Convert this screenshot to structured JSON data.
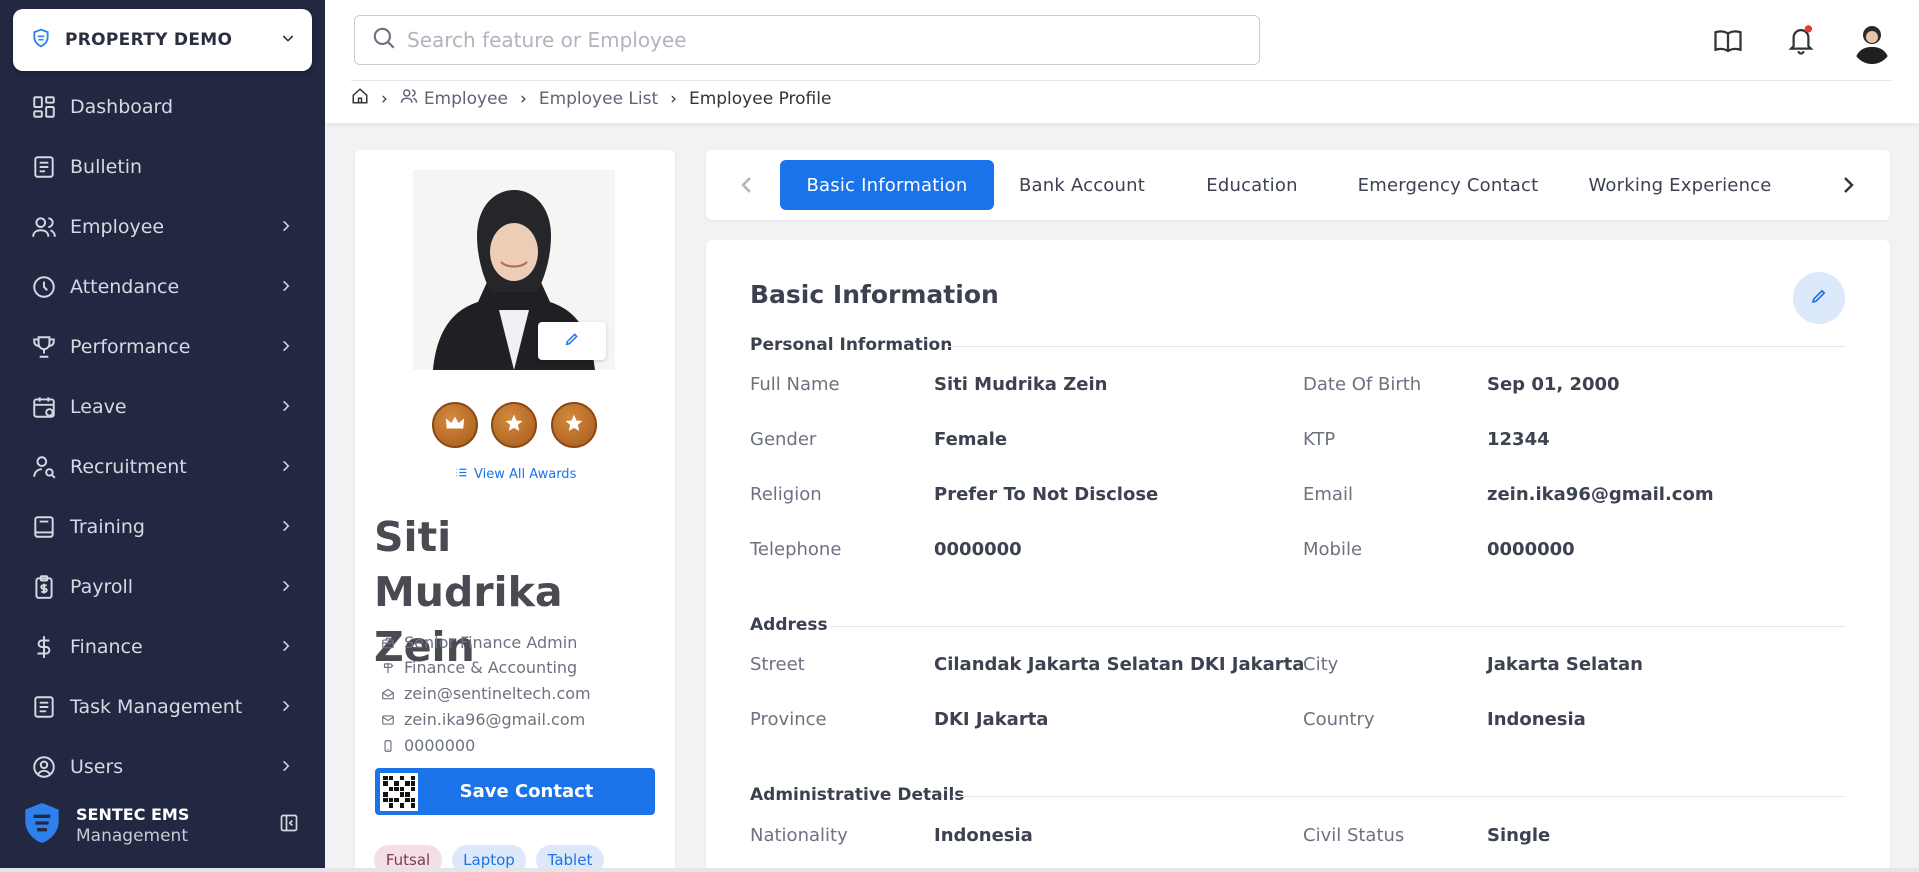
{
  "sidebar": {
    "property": "PROPERTY DEMO",
    "items": [
      {
        "label": "Dashboard",
        "icon": "dashboard-icon",
        "has_children": false
      },
      {
        "label": "Bulletin",
        "icon": "bulletin-icon",
        "has_children": false
      },
      {
        "label": "Employee",
        "icon": "users-icon",
        "has_children": true
      },
      {
        "label": "Attendance",
        "icon": "clock-icon",
        "has_children": true
      },
      {
        "label": "Performance",
        "icon": "trophy-icon",
        "has_children": true
      },
      {
        "label": "Leave",
        "icon": "calendar-icon",
        "has_children": true
      },
      {
        "label": "Recruitment",
        "icon": "user-search-icon",
        "has_children": true
      },
      {
        "label": "Training",
        "icon": "book-icon",
        "has_children": true
      },
      {
        "label": "Payroll",
        "icon": "clipboard-dollar-icon",
        "has_children": true
      },
      {
        "label": "Finance",
        "icon": "dollar-icon",
        "has_children": true
      },
      {
        "label": "Task Management",
        "icon": "task-icon",
        "has_children": true
      },
      {
        "label": "Users",
        "icon": "user-circle-icon",
        "has_children": true
      }
    ],
    "brand_name": "SENTEC EMS",
    "brand_sub": "Management"
  },
  "header": {
    "search_placeholder": "Search feature or Employee",
    "breadcrumb": [
      "Employee",
      "Employee List",
      "Employee Profile"
    ]
  },
  "profile": {
    "view_awards": "View All Awards",
    "name": "Siti Mudrika Zein",
    "title": "Senior Finance Admin",
    "department": "Finance & Accounting",
    "work_email": "zein@sentineltech.com",
    "email": "zein.ika96@gmail.com",
    "phone": "0000000",
    "save_contact": "Save Contact",
    "tags": [
      "Futsal",
      "Laptop",
      "Tablet"
    ]
  },
  "tabs": [
    "Basic Information",
    "Bank Account",
    "Education",
    "Emergency Contact",
    "Working Experience"
  ],
  "active_tab": "Basic Information",
  "basic": {
    "heading": "Basic Information",
    "personal": {
      "title": "Personal Information",
      "fields": [
        {
          "label": "Full Name",
          "value": "Siti Mudrika Zein"
        },
        {
          "label": "Date Of Birth",
          "value": "Sep 01, 2000"
        },
        {
          "label": "Gender",
          "value": "Female"
        },
        {
          "label": "KTP",
          "value": "12344"
        },
        {
          "label": "Religion",
          "value": "Prefer To Not Disclose"
        },
        {
          "label": "Email",
          "value": "zein.ika96@gmail.com"
        },
        {
          "label": "Telephone",
          "value": "0000000"
        },
        {
          "label": "Mobile",
          "value": "0000000"
        }
      ]
    },
    "address": {
      "title": "Address",
      "fields": [
        {
          "label": "Street",
          "value": "Cilandak Jakarta Selatan DKI Jakarta"
        },
        {
          "label": "City",
          "value": "Jakarta Selatan"
        },
        {
          "label": "Province",
          "value": "DKI Jakarta"
        },
        {
          "label": "Country",
          "value": "Indonesia"
        }
      ]
    },
    "admin": {
      "title": "Administrative Details",
      "fields": [
        {
          "label": "Nationality",
          "value": "Indonesia"
        },
        {
          "label": "Civil Status",
          "value": "Single"
        }
      ]
    }
  },
  "colors": {
    "sidebar_bg": "#232842",
    "accent": "#1a73e8",
    "badge": "#b5651d",
    "notification_dot": "#e53935"
  }
}
